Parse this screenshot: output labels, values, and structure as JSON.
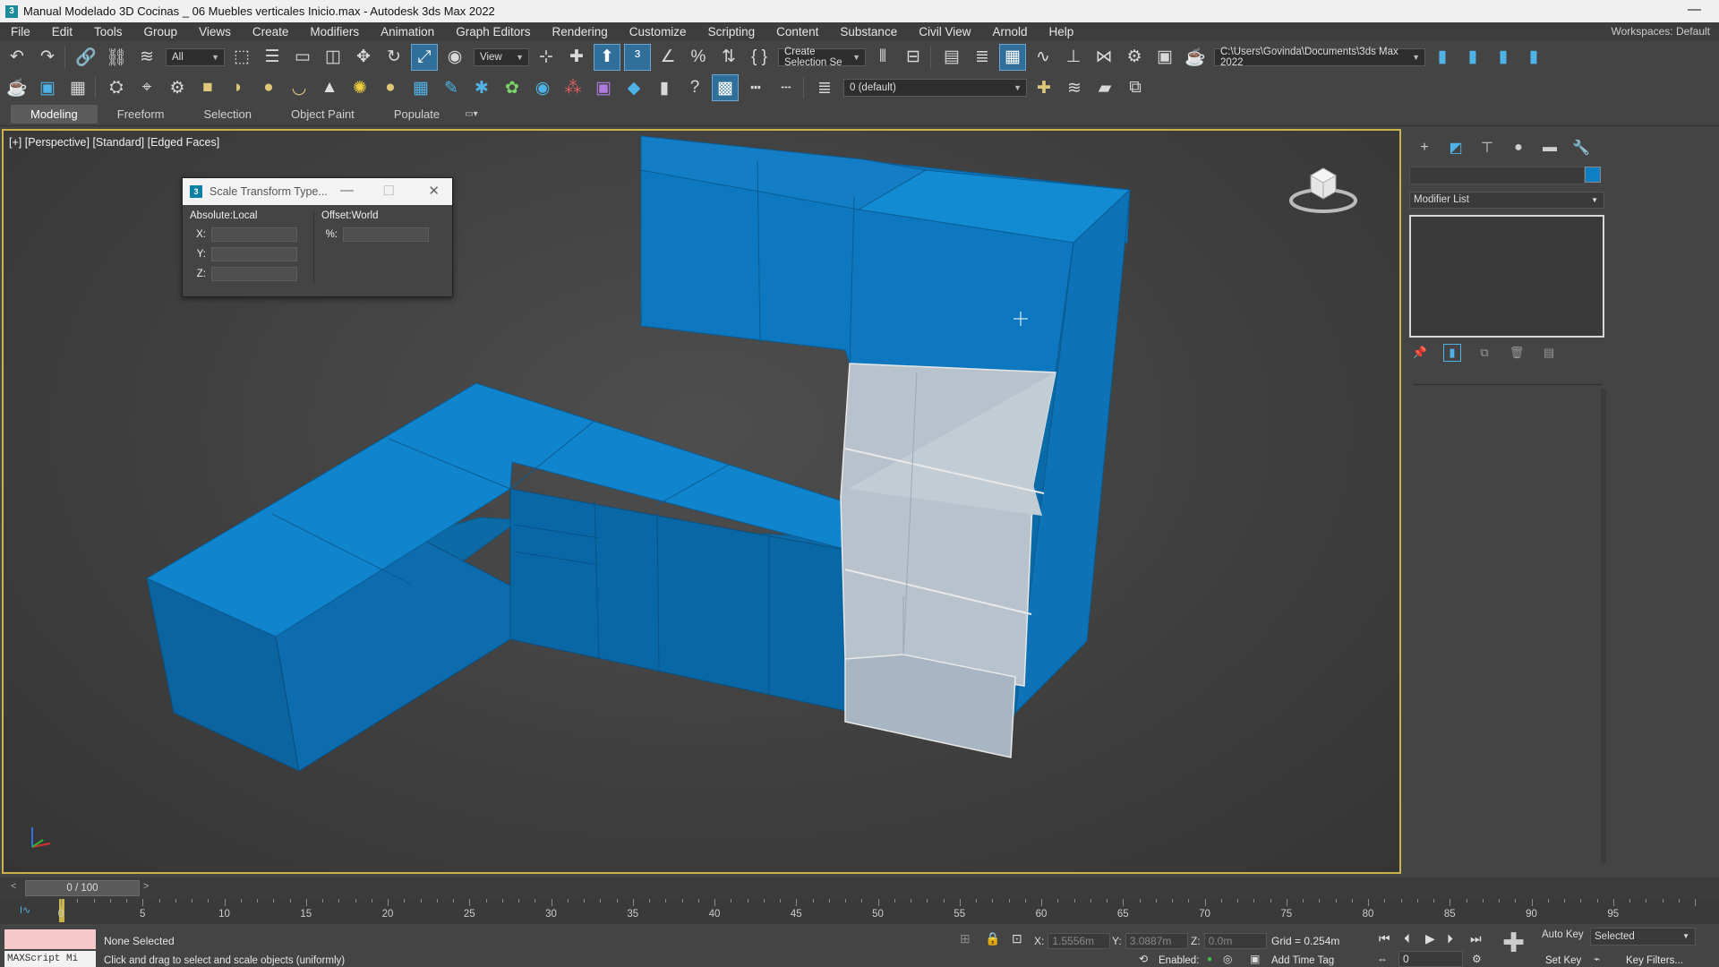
{
  "window": {
    "title": "Manual Modelado 3D Cocinas _ 06 Muebles verticales Inicio.max - Autodesk 3ds Max 2022",
    "minimize": "—"
  },
  "menu": {
    "items": [
      "File",
      "Edit",
      "Tools",
      "Group",
      "Views",
      "Create",
      "Modifiers",
      "Animation",
      "Graph Editors",
      "Rendering",
      "Customize",
      "Scripting",
      "Content",
      "Substance",
      "Civil View",
      "Arnold",
      "Help"
    ],
    "workspaces_label": "Workspaces: Default"
  },
  "toolbar": {
    "filter_value": "All",
    "ref_coord_value": "View",
    "selection_set_value": "Create Selection Se",
    "project_path": "C:\\Users\\Govinda\\Documents\\3ds Max 2022",
    "layer_value": "0 (default)"
  },
  "ribbon": {
    "tabs": [
      "Modeling",
      "Freeform",
      "Selection",
      "Object Paint",
      "Populate"
    ]
  },
  "viewport": {
    "label": "[+] [Perspective] [Standard] [Edged Faces]",
    "mesh_color": "#0f7cc0",
    "selected_face_color": "#b9c4cf"
  },
  "dialog": {
    "title": "Scale Transform Type...",
    "absolute_header": "Absolute:Local",
    "offset_header": "Offset:World",
    "x_label": "X:",
    "y_label": "Y:",
    "z_label": "Z:",
    "percent_label": "%:"
  },
  "command_panel": {
    "modifier_list": "Modifier List",
    "object_color": "#0e7fc4"
  },
  "timeline": {
    "frame_display": "0 / 100",
    "ticks": [
      0,
      5,
      10,
      15,
      20,
      25,
      30,
      35,
      40,
      45,
      50,
      55,
      60,
      65,
      70,
      75,
      80,
      85,
      90,
      95
    ]
  },
  "status": {
    "selection": "None Selected",
    "prompt": "Click and drag to select and scale objects (uniformly)",
    "maxscript": "MAXScript Mi",
    "x_label": "X:",
    "x_value": "1.5556m",
    "y_label": "Y:",
    "y_value": "3.0887m",
    "z_label": "Z:",
    "z_value": "0.0m",
    "grid": "Grid = 0.254m",
    "enabled": "Enabled:",
    "add_time_tag": "Add Time Tag",
    "auto_key": "Auto Key",
    "set_key": "Set Key",
    "selected_value": "Selected",
    "key_filters": "Key Filters...",
    "frame_value": "0"
  }
}
